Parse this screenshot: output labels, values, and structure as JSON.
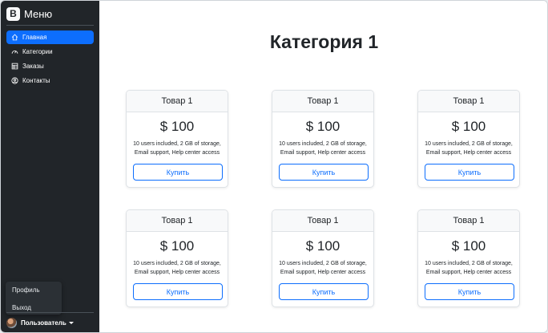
{
  "sidebar": {
    "brand_logo": "B",
    "brand_text": "Меню",
    "items": [
      {
        "label": "Главная",
        "icon": "home-icon",
        "active": true
      },
      {
        "label": "Категории",
        "icon": "speedometer-icon",
        "active": false
      },
      {
        "label": "Заказы",
        "icon": "table-icon",
        "active": false
      },
      {
        "label": "Контакты",
        "icon": "person-circle-icon",
        "active": false
      }
    ],
    "dropdown": {
      "items": [
        "Профиль",
        "Выход"
      ]
    },
    "user_label": "Пользователь"
  },
  "main": {
    "title": "Категория 1",
    "cards": [
      {
        "name": "Товар 1",
        "price": "$ 100",
        "desc1": "10 users included, 2 GB of storage,",
        "desc2": "Email support, Help center access",
        "button": "Купить"
      },
      {
        "name": "Товар 1",
        "price": "$ 100",
        "desc1": "10 users included, 2 GB of storage,",
        "desc2": "Email support, Help center access",
        "button": "Купить"
      },
      {
        "name": "Товар 1",
        "price": "$ 100",
        "desc1": "10 users included, 2 GB of storage,",
        "desc2": "Email support, Help center access",
        "button": "Купить"
      },
      {
        "name": "Товар 1",
        "price": "$ 100",
        "desc1": "10 users included, 2 GB of storage,",
        "desc2": "Email support, Help center access",
        "button": "Купить"
      },
      {
        "name": "Товар 1",
        "price": "$ 100",
        "desc1": "10 users included, 2 GB of storage,",
        "desc2": "Email support, Help center access",
        "button": "Купить"
      },
      {
        "name": "Товар 1",
        "price": "$ 100",
        "desc1": "10 users included, 2 GB of storage,",
        "desc2": "Email support, Help center access",
        "button": "Купить"
      }
    ]
  },
  "colors": {
    "sidebar_bg": "#212529",
    "accent": "#0d6efd",
    "card_header_bg": "#f8f9fa"
  }
}
